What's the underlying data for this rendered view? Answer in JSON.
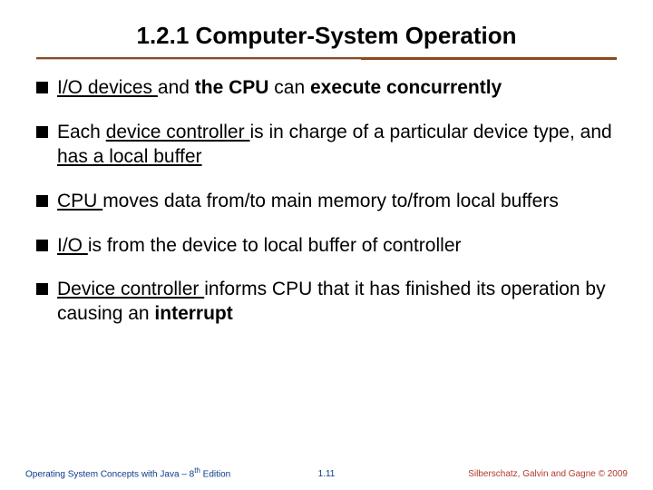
{
  "title": "1.2.1 Computer-System Operation",
  "bullets": [
    {
      "segments": [
        {
          "text": "I/O devices ",
          "u": true,
          "b": false
        },
        {
          "text": "and",
          "u": false,
          "b": false
        },
        {
          "text": " the CPU ",
          "u": false,
          "b": true
        },
        {
          "text": "can",
          "u": false,
          "b": false
        },
        {
          "text": " execute concurrently",
          "u": false,
          "b": true
        }
      ]
    },
    {
      "segments": [
        {
          "text": "Each ",
          "u": false,
          "b": false
        },
        {
          "text": "device controller ",
          "u": true,
          "b": false
        },
        {
          "text": "is in charge of a particular device type, and ",
          "u": false,
          "b": false
        },
        {
          "text": "has a local buffer",
          "u": true,
          "b": false
        }
      ]
    },
    {
      "segments": [
        {
          "text": "CPU ",
          "u": true,
          "b": false
        },
        {
          "text": "moves data from/to main memory to/from local buffers",
          "u": false,
          "b": false
        }
      ]
    },
    {
      "segments": [
        {
          "text": "I/O ",
          "u": true,
          "b": false
        },
        {
          "text": "is from the device to local buffer of controller",
          "u": false,
          "b": false
        }
      ]
    },
    {
      "segments": [
        {
          "text": "Device controller ",
          "u": true,
          "b": false
        },
        {
          "text": "informs CPU that it has finished its operation by causing an ",
          "u": false,
          "b": false
        },
        {
          "text": "interrupt",
          "u": false,
          "b": true
        }
      ]
    }
  ],
  "footer": {
    "left_prefix": "Operating System Concepts  with Java – 8",
    "left_sup": "th",
    "left_suffix": " Edition",
    "center": "1.11",
    "right": "Silberschatz, Galvin and Gagne © 2009"
  }
}
